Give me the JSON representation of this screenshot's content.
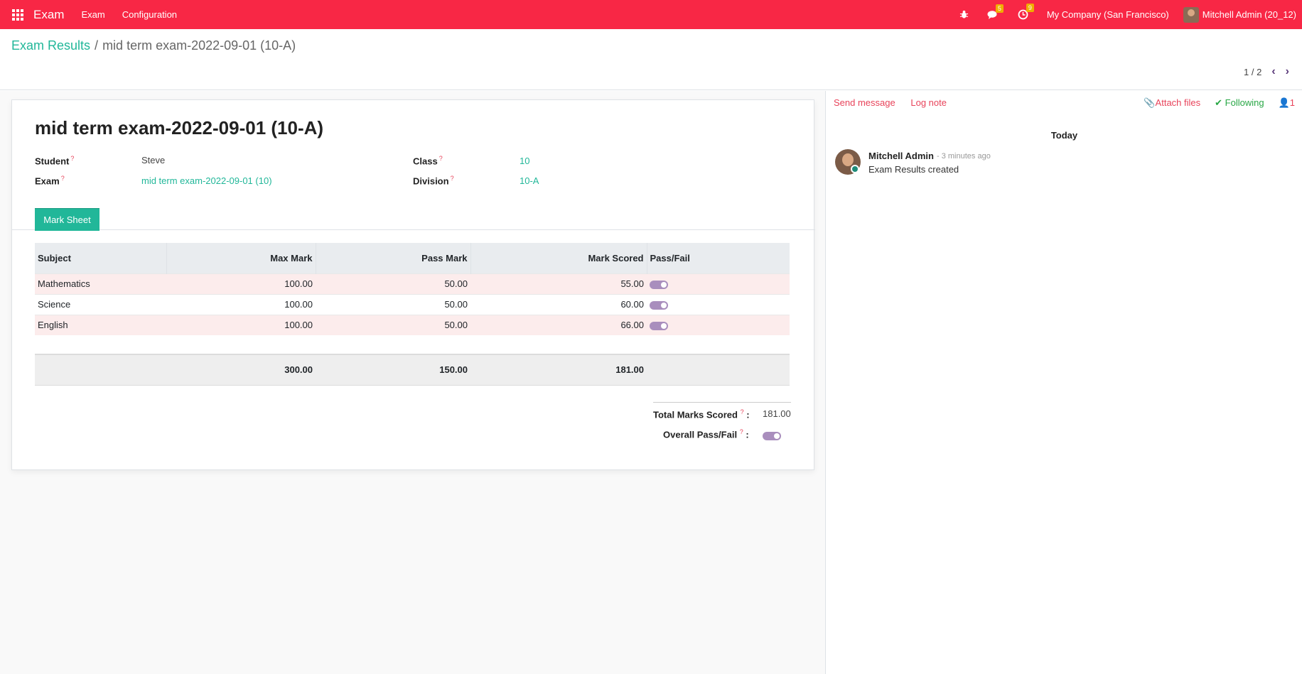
{
  "navbar": {
    "app_name": "Exam",
    "menus": [
      "Exam",
      "Configuration"
    ],
    "messages_badge": "5",
    "activities_badge": "9",
    "company": "My Company (San Francisco)",
    "user": "Mitchell Admin (20_12)",
    "accent_color": "#f82745"
  },
  "breadcrumb": {
    "parent": "Exam Results",
    "current": "mid term exam-2022-09-01 (10-A)"
  },
  "pager": {
    "value": "1 / 2"
  },
  "record": {
    "title": "mid term exam-2022-09-01 (10-A)",
    "student_label": "Student",
    "student_value": "Steve",
    "exam_label": "Exam",
    "exam_value": "mid term exam-2022-09-01 (10)",
    "class_label": "Class",
    "class_value": "10",
    "division_label": "Division",
    "division_value": "10-A",
    "required_mark": "?"
  },
  "tabs": {
    "mark_sheet": "Mark Sheet"
  },
  "table": {
    "headers": [
      "Subject",
      "Max Mark",
      "Pass Mark",
      "Mark Scored",
      "Pass/Fail"
    ],
    "rows": [
      {
        "subject": "Mathematics",
        "max": "100.00",
        "pass": "50.00",
        "scored": "55.00",
        "passed": true
      },
      {
        "subject": "Science",
        "max": "100.00",
        "pass": "50.00",
        "scored": "60.00",
        "passed": true
      },
      {
        "subject": "English",
        "max": "100.00",
        "pass": "50.00",
        "scored": "66.00",
        "passed": true
      }
    ],
    "totals": {
      "max": "300.00",
      "pass": "150.00",
      "scored": "181.00"
    }
  },
  "summary": {
    "total_label": "Total Marks Scored",
    "total_value": "181.00",
    "overall_label": "Overall Pass/Fail",
    "colon": ":",
    "overall_passed": true
  },
  "chatter": {
    "send_message": "Send message",
    "log_note": "Log note",
    "attach_files": "Attach files",
    "following": "Following",
    "followers_count": "1",
    "date_separator": "Today",
    "message": {
      "author": "Mitchell Admin",
      "time": "- 3 minutes ago",
      "body": "Exam Results created"
    }
  }
}
